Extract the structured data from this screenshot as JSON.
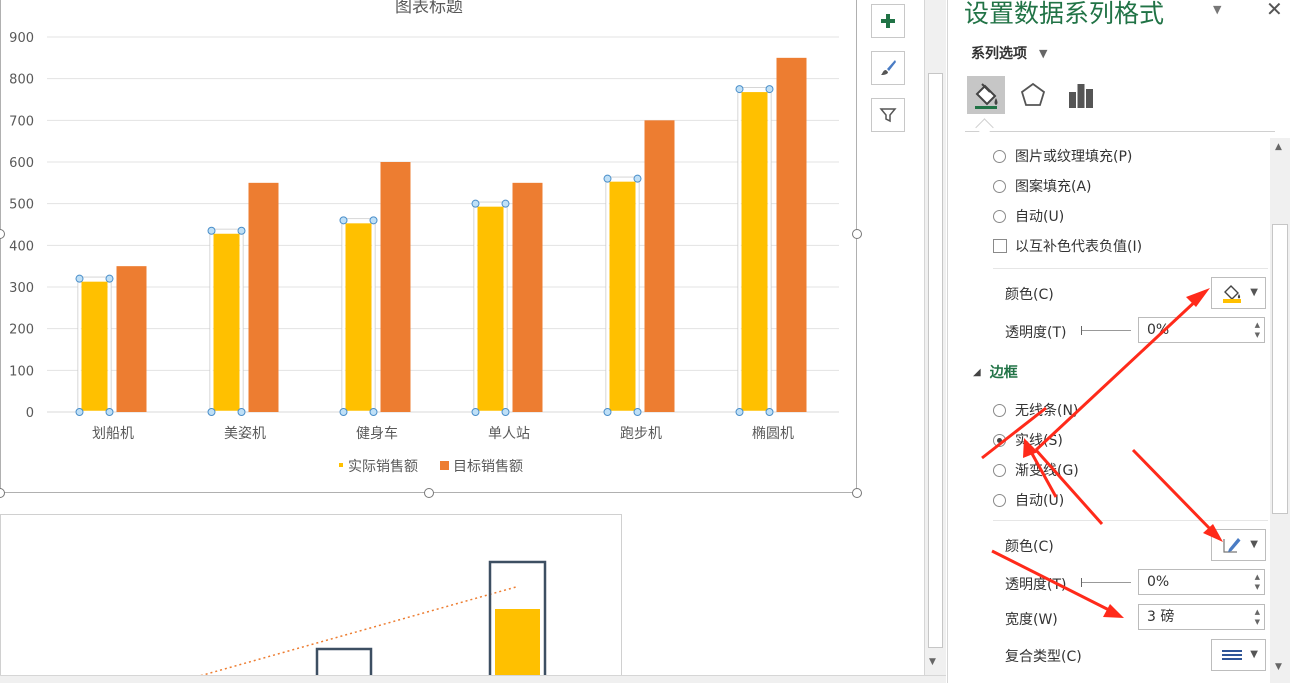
{
  "chart_data": {
    "type": "bar",
    "title": "图表标题",
    "categories": [
      "划船机",
      "美姿机",
      "健身车",
      "单人站",
      "跑步机",
      "椭圆机"
    ],
    "series": [
      {
        "name": "实际销售额",
        "values": [
          320,
          435,
          460,
          500,
          560,
          775
        ],
        "color": "#FFC000"
      },
      {
        "name": "目标销售额",
        "values": [
          350,
          550,
          600,
          550,
          700,
          850
        ],
        "color": "#ED7D31"
      }
    ],
    "ylim": [
      0,
      900
    ],
    "yticks": [
      0,
      100,
      200,
      300,
      400,
      500,
      600,
      700,
      800,
      900
    ],
    "grid": true,
    "legend": "bottom",
    "selected_series": "实际销售额"
  },
  "pane": {
    "title": "设置数据系列格式",
    "series_options_label": "系列选项",
    "tabs": [
      {
        "icon": "paint-bucket-icon"
      },
      {
        "icon": "pentagon-icon"
      },
      {
        "icon": "bar-chart-icon"
      }
    ],
    "fill_options": [
      {
        "label": "图片或纹理填充(P)",
        "checked": false
      },
      {
        "label": "图案填充(A)",
        "checked": false
      },
      {
        "label": "自动(U)",
        "checked": false
      }
    ],
    "invert_if_negative": "以互补色代表负值(I)",
    "fill_color_label": "颜色(C)",
    "fill_transparency_label": "透明度(T)",
    "fill_transparency_value": "0%",
    "border_header": "边框",
    "border_options": [
      {
        "label": "无线条(N)",
        "checked": false
      },
      {
        "label": "实线(S)",
        "checked": true
      },
      {
        "label": "渐变线(G)",
        "checked": false
      },
      {
        "label": "自动(U)",
        "checked": false
      }
    ],
    "border_color_label": "颜色(C)",
    "border_transparency_label": "透明度(T)",
    "border_transparency_value": "0%",
    "width_label": "宽度(W)",
    "width_value": "3 磅",
    "compound_type_label": "复合类型(C)"
  },
  "colors": {
    "accent": "#217346",
    "actual": "#FFC000",
    "target": "#ED7D31",
    "arrow": "#FF2A1A",
    "bar_outline": "#3D4F62"
  }
}
